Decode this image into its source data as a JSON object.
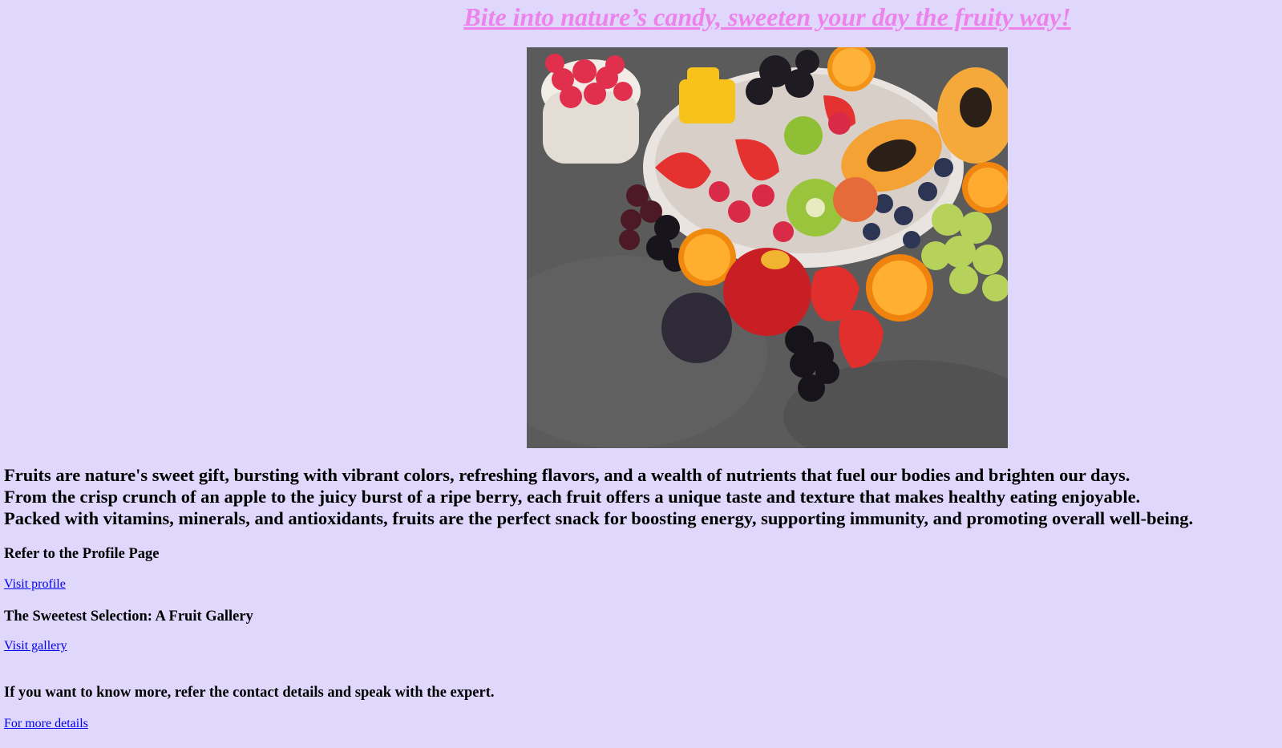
{
  "headline": "Bite into nature’s candy, sweeten your day the fruity way!",
  "hero_image": {
    "description_icon": "fruit-platter-image"
  },
  "intro": {
    "lines": [
      "Fruits are nature's sweet gift, bursting with vibrant colors, refreshing flavors, and a wealth of nutrients that fuel our bodies and brighten our days.",
      "From the crisp crunch of an apple to the juicy burst of a ripe berry, each fruit offers a unique taste and texture that makes healthy eating enjoyable.",
      "Packed with vitamins, minerals, and antioxidants, fruits are the perfect snack for boosting energy, supporting immunity, and promoting overall well-being."
    ]
  },
  "sections": {
    "profile": {
      "title": "Refer to the Profile Page",
      "link": "Visit profile"
    },
    "gallery": {
      "title": "The Sweetest Selection: A Fruit Gallery",
      "link": "Visit gallery"
    },
    "contact": {
      "title": "If you want to know more, refer the contact details and speak with the expert.",
      "link": "For more details"
    }
  },
  "colors": {
    "background": "#e0d7fd",
    "headline": "#ec82ea",
    "link": "#0000ee"
  }
}
